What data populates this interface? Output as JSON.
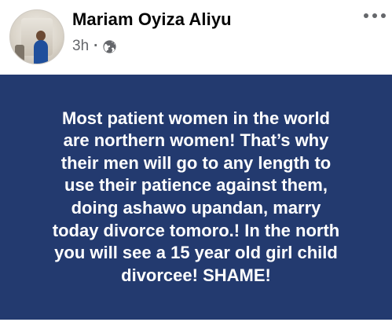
{
  "post": {
    "author_name": "Mariam Oyiza Aliyu",
    "time": "3h",
    "separator": "·",
    "audience_icon": "globe-icon",
    "more_icon": "more-options-icon",
    "text": "Most patient women in the world\nare northern women! That’s why\ntheir men will go to any length to\nuse their patience against them,\ndoing ashawo upandan, marry\ntoday divorce tomoro.!  In the north\nyou will see a 15 year old girl child\ndivorcee! SHAME!",
    "background_color": "#233a6f",
    "text_color": "#ffffff"
  }
}
